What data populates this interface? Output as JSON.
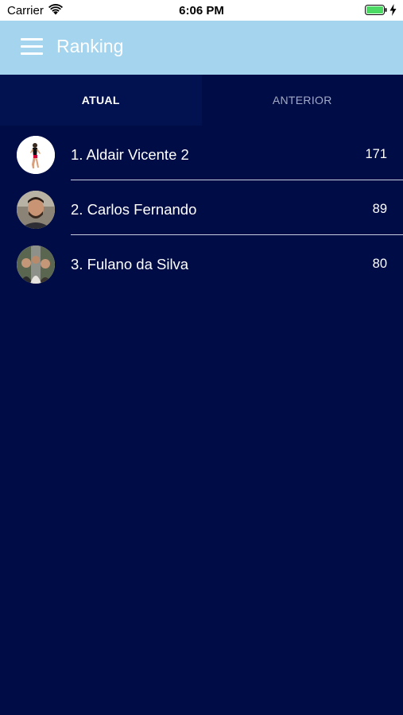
{
  "status_bar": {
    "carrier": "Carrier",
    "time": "6:06 PM",
    "battery_level": 1.0,
    "icons": [
      "wifi-icon",
      "battery-icon",
      "charging-bolt-icon"
    ]
  },
  "app_bar": {
    "title": "Ranking",
    "menu_icon": "hamburger-menu-icon",
    "color": "#a4d4ee"
  },
  "tabs": [
    {
      "label": "ATUAL",
      "active": true
    },
    {
      "label": "ANTERIOR",
      "active": false
    }
  ],
  "ranking": [
    {
      "position_label": "1. Aldair Vicente 2",
      "score": "171",
      "avatar": "avatar-runner-photo"
    },
    {
      "position_label": "2. Carlos Fernando",
      "score": "89",
      "avatar": "avatar-man-photo"
    },
    {
      "position_label": "3. Fulano da Silva",
      "score": "80",
      "avatar": "avatar-group-photo"
    }
  ],
  "colors": {
    "background": "#000c45",
    "active_tab": "#021150",
    "text": "#ffffff",
    "inactive_tab_text": "#a3abc7"
  }
}
